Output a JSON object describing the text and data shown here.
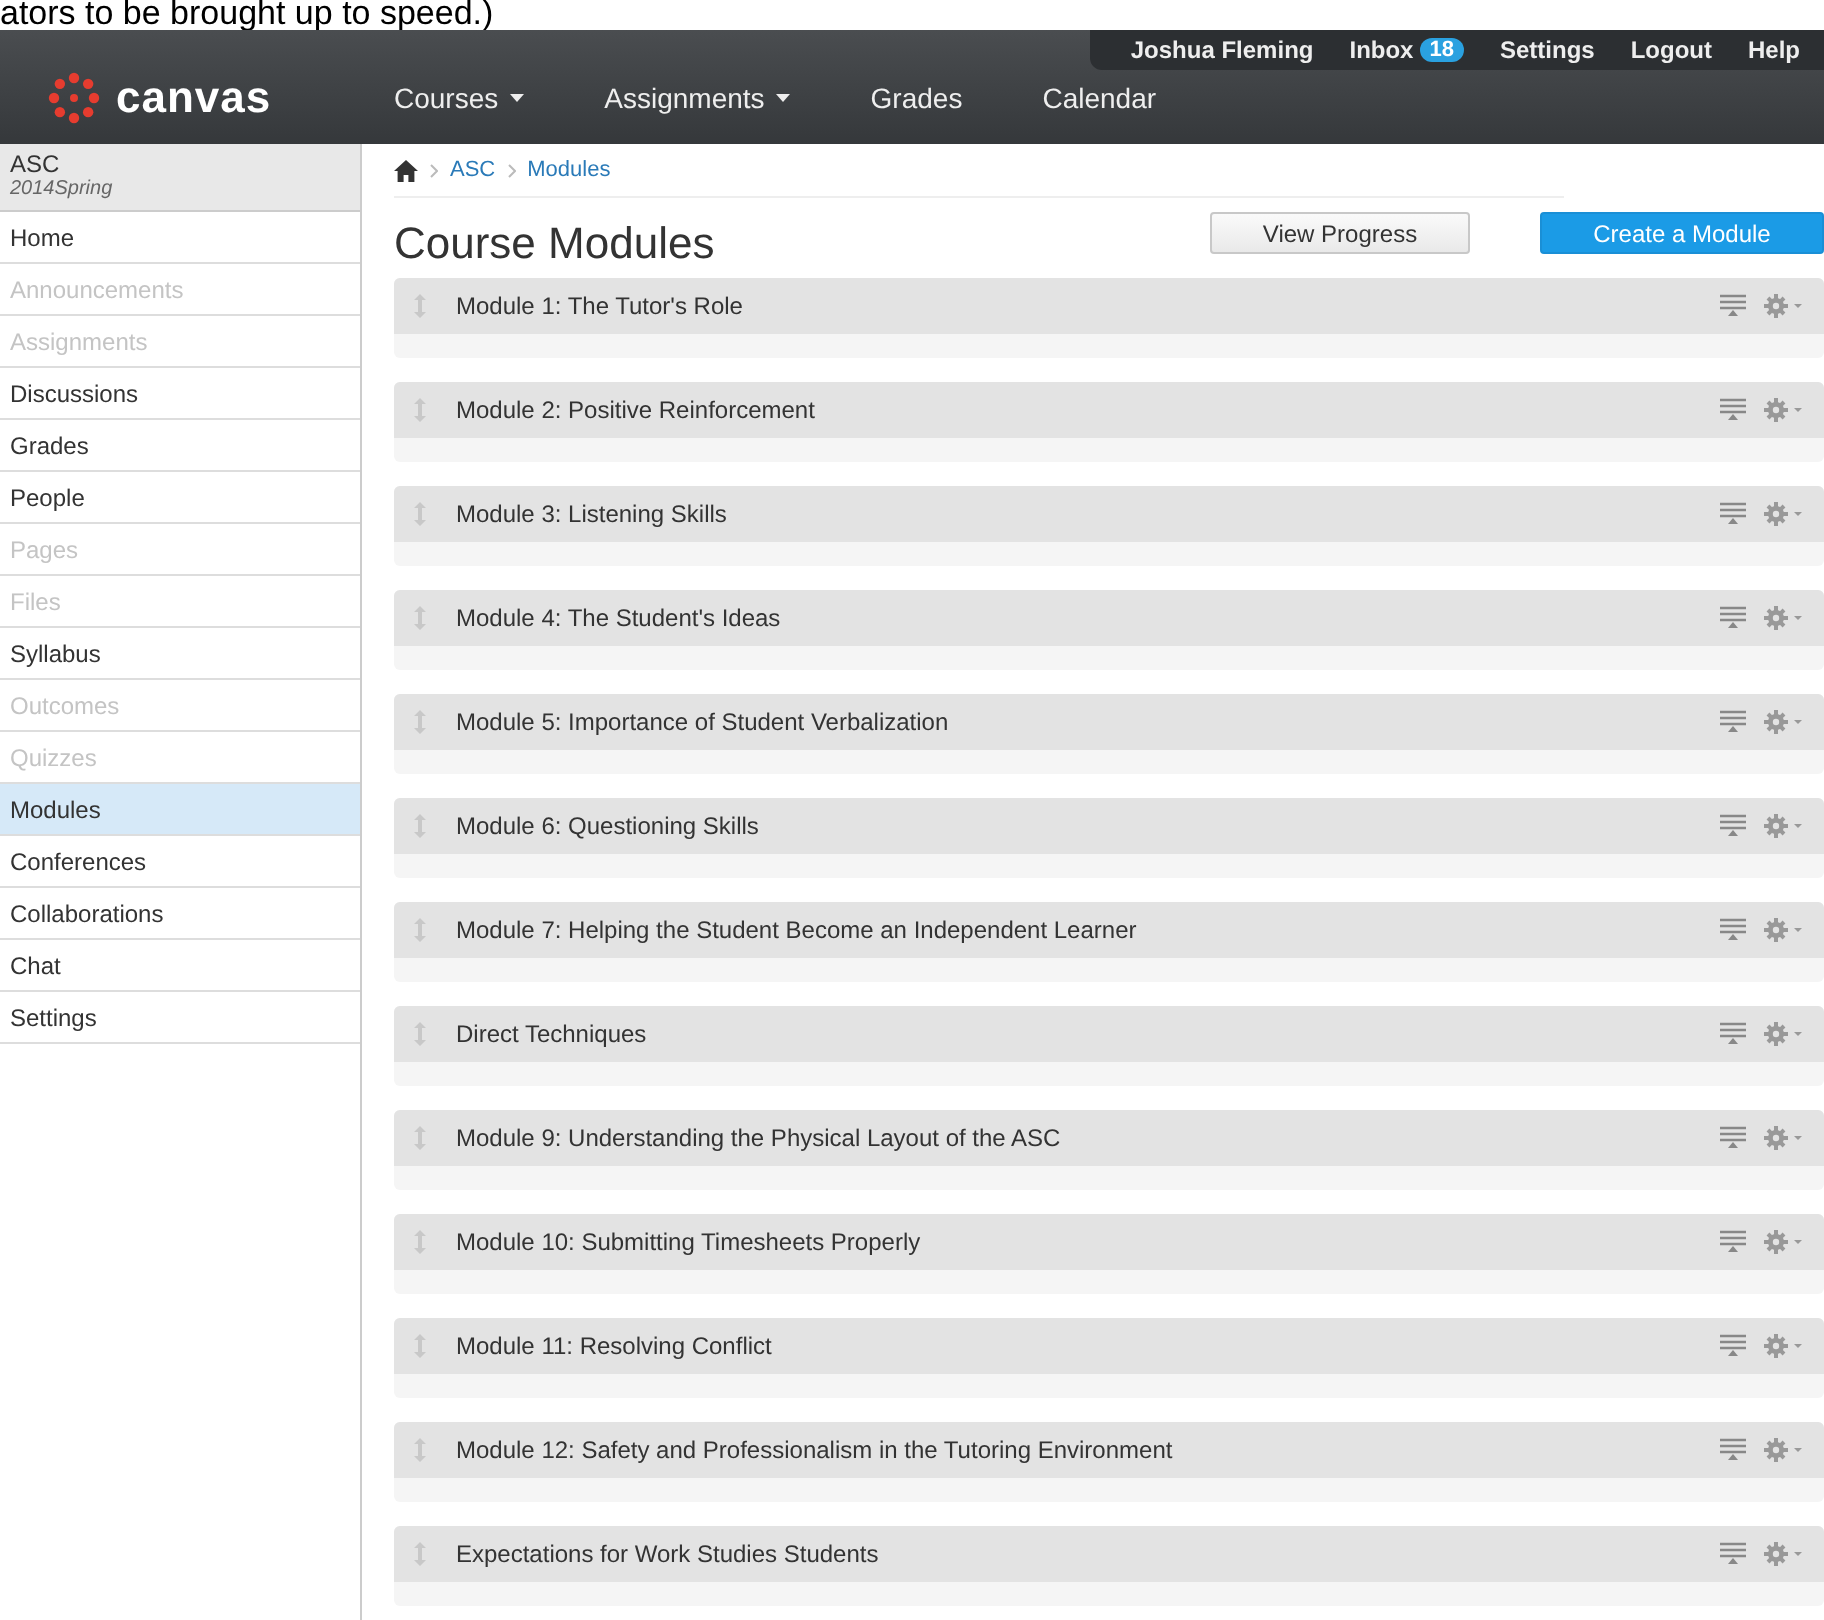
{
  "caption": "ators to be brought up to speed.)",
  "user_menu": {
    "user": "Joshua Fleming",
    "inbox": "Inbox",
    "inbox_count": "18",
    "links": [
      "Settings",
      "Logout",
      "Help"
    ]
  },
  "logo": "canvas",
  "nav": [
    {
      "label": "Courses",
      "dropdown": true
    },
    {
      "label": "Assignments",
      "dropdown": true
    },
    {
      "label": "Grades",
      "dropdown": false
    },
    {
      "label": "Calendar",
      "dropdown": false
    }
  ],
  "course": {
    "name": "ASC",
    "term": "2014Spring"
  },
  "sidebar": {
    "items": [
      {
        "label": "Home",
        "disabled": false,
        "selected": false
      },
      {
        "label": "Announcements",
        "disabled": true,
        "selected": false
      },
      {
        "label": "Assignments",
        "disabled": true,
        "selected": false
      },
      {
        "label": "Discussions",
        "disabled": false,
        "selected": false
      },
      {
        "label": "Grades",
        "disabled": false,
        "selected": false
      },
      {
        "label": "People",
        "disabled": false,
        "selected": false
      },
      {
        "label": "Pages",
        "disabled": true,
        "selected": false
      },
      {
        "label": "Files",
        "disabled": true,
        "selected": false
      },
      {
        "label": "Syllabus",
        "disabled": false,
        "selected": false
      },
      {
        "label": "Outcomes",
        "disabled": true,
        "selected": false
      },
      {
        "label": "Quizzes",
        "disabled": true,
        "selected": false
      },
      {
        "label": "Modules",
        "disabled": false,
        "selected": true
      },
      {
        "label": "Conferences",
        "disabled": false,
        "selected": false
      },
      {
        "label": "Collaborations",
        "disabled": false,
        "selected": false
      },
      {
        "label": "Chat",
        "disabled": false,
        "selected": false
      },
      {
        "label": "Settings",
        "disabled": false,
        "selected": false
      }
    ]
  },
  "breadcrumb": [
    "ASC",
    "Modules"
  ],
  "title": "Course Modules",
  "buttons": [
    {
      "label": "View Progress",
      "kind": "secondary"
    },
    {
      "label": "Create a Module",
      "kind": "primary"
    }
  ],
  "modules": [
    "Module 1: The Tutor's Role",
    "Module 2: Positive Reinforcement",
    "Module 3: Listening Skills",
    "Module 4: The Student's Ideas",
    "Module 5: Importance of Student Verbalization",
    "Module 6: Questioning Skills",
    "Module 7: Helping the Student Become an Independent Learner",
    "Direct Techniques",
    "Module 9: Understanding the Physical Layout of the ASC",
    "Module 10: Submitting Timesheets Properly",
    "Module 11: Resolving Conflict",
    "Module 12: Safety and Professionalism in the Tutoring Environment",
    "Expectations for Work Studies Students"
  ]
}
